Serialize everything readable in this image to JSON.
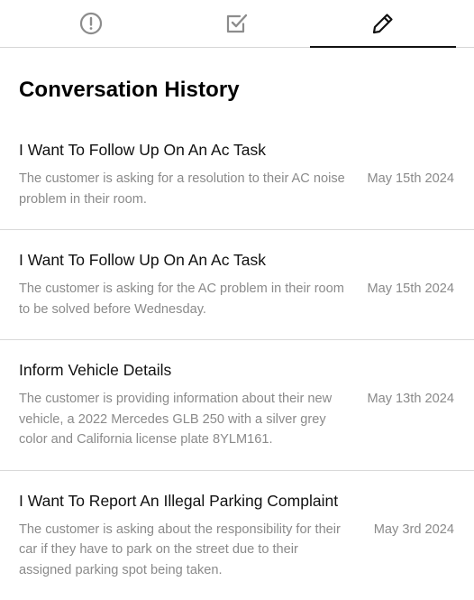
{
  "tabs": [
    {
      "icon": "alert-circle-icon",
      "active": false
    },
    {
      "icon": "checkbox-icon",
      "active": false
    },
    {
      "icon": "pencil-icon",
      "active": true
    }
  ],
  "page": {
    "title": "Conversation History"
  },
  "conversations": [
    {
      "title": "I Want To Follow Up On An Ac Task",
      "description": "The customer is asking for a resolution to their AC noise problem in their room.",
      "date": "May 15th 2024"
    },
    {
      "title": "I Want To Follow Up On An Ac Task",
      "description": "The customer is asking for the AC problem in their room to be solved before Wednesday.",
      "date": "May 15th 2024"
    },
    {
      "title": "Inform Vehicle Details",
      "description": "The customer is providing information about their new vehicle, a 2022 Mercedes GLB 250 with a silver grey color and California license plate 8YLM161.",
      "date": "May 13th 2024"
    },
    {
      "title": "I Want To Report An Illegal Parking Complaint",
      "description": "The customer is asking about the responsibility for their car if they have to park on the street due to their assigned parking spot being taken.",
      "date": "May 3rd 2024"
    }
  ]
}
